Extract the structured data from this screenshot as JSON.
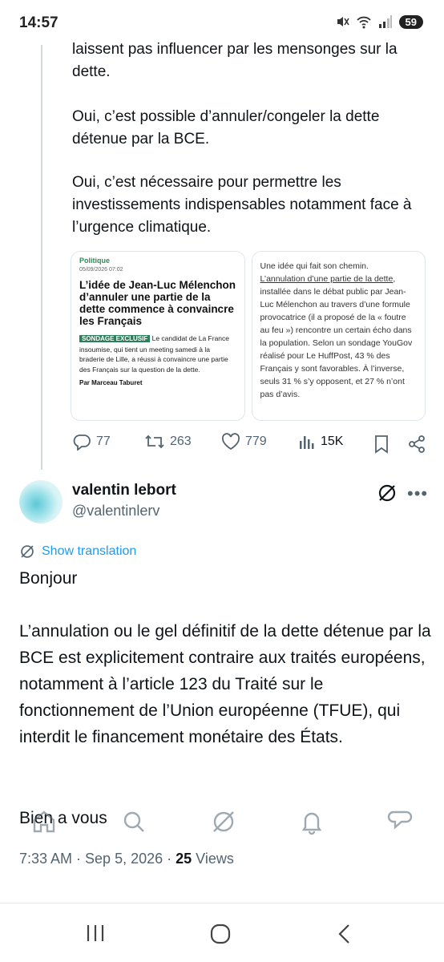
{
  "status_bar": {
    "time": "14:57",
    "battery": "59"
  },
  "tweet": {
    "paragraphs": [
      "laissent pas influencer par les mensonges sur la dette.",
      "Oui, c’est possible d’annuler/congeler la dette détenue par la BCE.",
      "Oui, c’est nécessaire pour permettre les investissements indispensables notamment face à l’urgence climatique."
    ],
    "card_left": {
      "section": "Politique",
      "date": "05/09/2026 07:02",
      "headline": "L’idée de Jean-Luc Mélenchon d’annuler une partie de la dette commence à convaincre les Français",
      "badge": "SONDAGE EXCLUSIF",
      "body": " Le candidat de La France insoumise, qui tient un meeting samedi à la braderie de Lille, a réussi à convaincre une partie des Français sur la question de la dette.",
      "author": "Par Marceau Taburet"
    },
    "card_right": {
      "intro": "Une idée qui fait son chemin.",
      "link": "L’annulation d’une partie de la dette",
      "text": ", installée dans le débat public par Jean-Luc Mélenchon au travers d’une formule provocatrice (il a proposé de la « foutre au feu ») rencontre un certain écho dans la population. Selon un sondage YouGov réalisé pour Le HuffPost, 43 % des Français y sont favorables. À l’inverse, seuls 31 % s’y opposent, et 27 % n’ont pas d’avis."
    },
    "actions": {
      "replies": "77",
      "reposts": "263",
      "likes": "779",
      "views": "15K"
    }
  },
  "reply": {
    "name": "valentin lebort",
    "handle": "@valentinlerv",
    "show_translation": "Show translation",
    "greeting": "Bonjour",
    "body": " L’annulation ou le gel définitif de la dette détenue par la BCE est explicitement contraire aux traités européens, notamment à l’article 123 du Traité sur le fonctionnement de l’Union européenne (TFUE), qui interdit le financement monétaire des États.",
    "closing": "Bien a vous",
    "time": "7:33 AM · Sep 5, 2026 · ",
    "views_count": "25",
    "views_label": " Views"
  },
  "colors": {
    "accent": "#1d9bf0",
    "muted": "#536471",
    "text": "#0f1419",
    "badge": "#2e7d5b"
  },
  "icons": [
    "mute-icon",
    "wifi-icon",
    "signal-icon",
    "reply-icon",
    "repost-icon",
    "like-icon",
    "views-icon",
    "bookmark-icon",
    "share-icon",
    "grok-icon",
    "more-icon",
    "translate-icon",
    "home-icon",
    "search-icon",
    "communities-icon",
    "notifications-icon",
    "messages-icon"
  ]
}
